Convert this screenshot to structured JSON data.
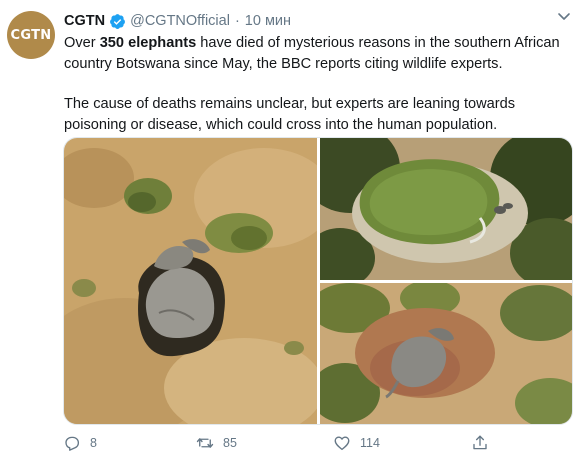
{
  "tweet": {
    "avatar_text": "CGTN",
    "author_name": "CGTN",
    "handle": "@CGTNOfficial",
    "separator": "·",
    "time": "10 мин",
    "para1": {
      "prefix": "Over ",
      "bold": "350 elephants",
      "suffix": " have died of mysterious reasons in the southern African country Botswana since May, the BBC reports citing wildlife experts."
    },
    "para2": "The cause of deaths remains unclear, but experts are leaning towards poisoning or disease, which could cross into the human population."
  },
  "media": {
    "photos": [
      "dead-elephant-on-dry-savanna",
      "waterhole-aerial",
      "elephant-lying-in-brush"
    ]
  },
  "actions": {
    "reply_count": "8",
    "retweet_count": "85",
    "like_count": "114"
  },
  "icons": {
    "verified": "verified-badge-icon",
    "menu": "chevron-down-icon",
    "reply": "reply-icon",
    "retweet": "retweet-icon",
    "like": "heart-icon",
    "share": "share-icon"
  },
  "colors": {
    "text": "#14171a",
    "secondary": "#657786",
    "verified": "#1da1f2",
    "avatar": "#b08a4a"
  }
}
